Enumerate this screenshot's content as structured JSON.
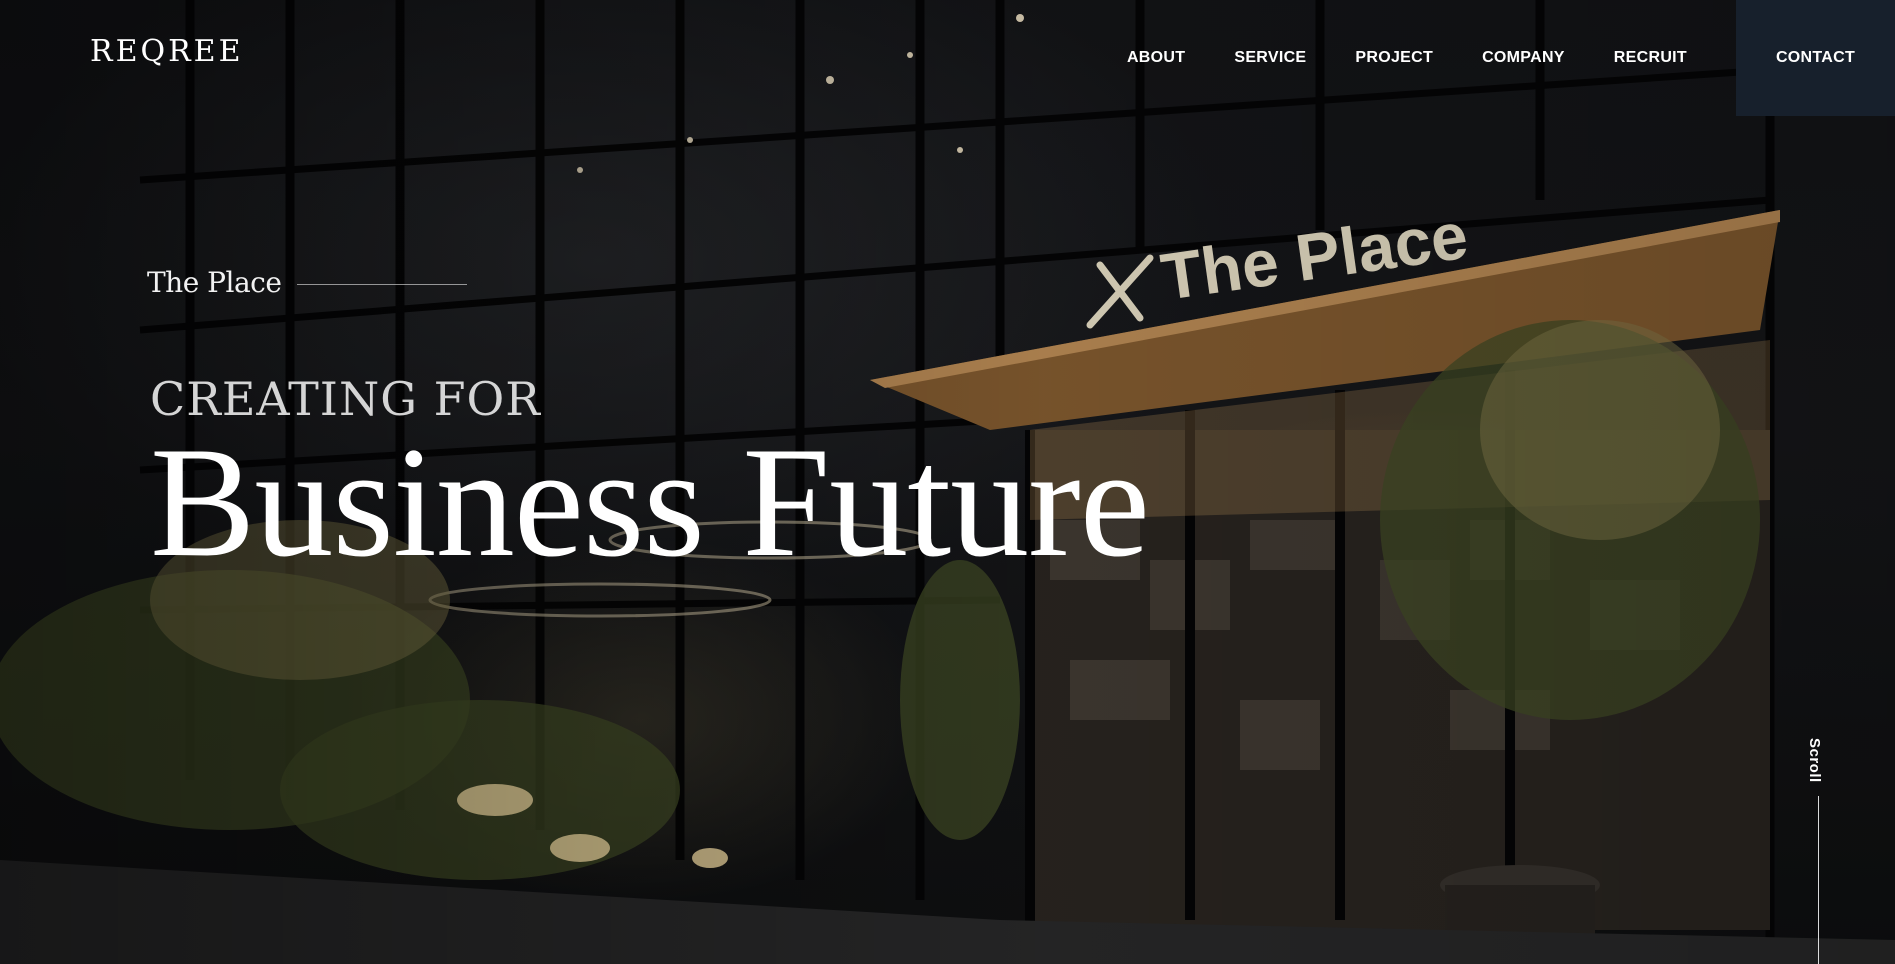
{
  "brand": {
    "logo": "REQREE"
  },
  "nav": {
    "items": [
      {
        "label": "ABOUT"
      },
      {
        "label": "SERVICE"
      },
      {
        "label": "PROJECT"
      },
      {
        "label": "COMPANY"
      },
      {
        "label": "RECRUIT"
      }
    ],
    "contact_label": "CONTACT",
    "contact_bg": "#17202c"
  },
  "hero": {
    "eyebrow": "The Place",
    "sub_headline": "CREATING FOR",
    "headline": "Business Future",
    "sign_text": "The Place",
    "scroll_label": "Scroll"
  }
}
